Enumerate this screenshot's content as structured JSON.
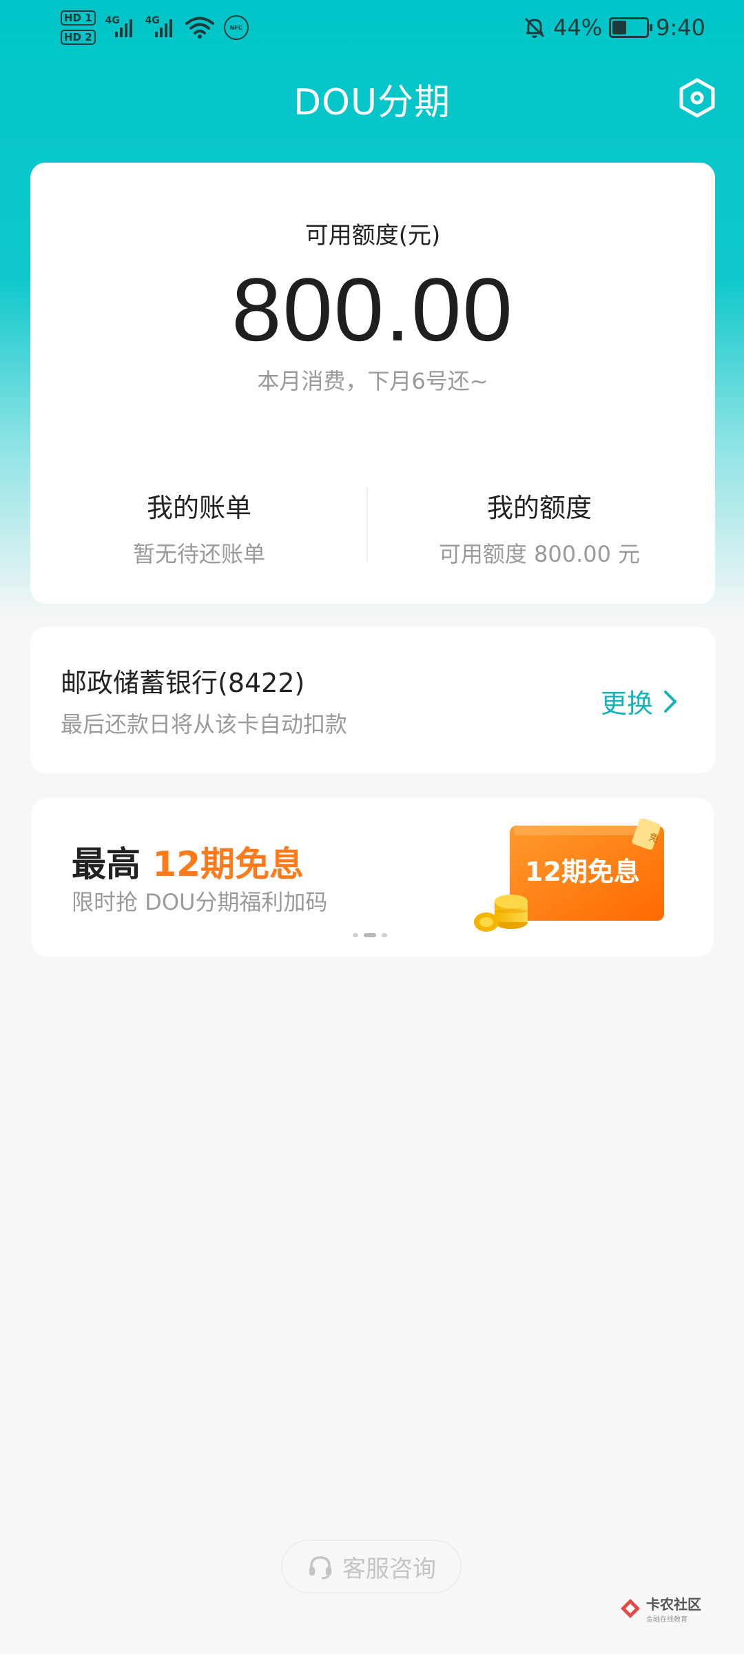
{
  "status_bar": {
    "hd1": "HD 1",
    "hd2": "HD 2",
    "net1": "4G",
    "net2": "4G",
    "nfc": "NFC",
    "battery_pct": "44%",
    "battery_level": 0.44,
    "time": "9:40"
  },
  "header": {
    "title": "DOU分期",
    "settings_icon": "settings-hexagon-icon"
  },
  "credit": {
    "label": "可用额度(元)",
    "amount": "800.00",
    "note": "本月消费，下月6号还~",
    "bill_title": "我的账单",
    "bill_sub": "暂无待还账单",
    "limit_title": "我的额度",
    "limit_sub": "可用额度 800.00 元"
  },
  "bank": {
    "name": "邮政储蓄银行(8422)",
    "note": "最后还款日将从该卡自动扣款",
    "change_label": "更换"
  },
  "promo": {
    "title_prefix": "最高 ",
    "title_highlight": "12期免息",
    "subtitle": "限时抢 DOU分期福利加码",
    "art_text": "12期免息",
    "art_tag": "免",
    "carousel_total": 3,
    "carousel_active": 2
  },
  "footer": {
    "service_label": "客服咨询",
    "watermark_main": "卡农社区",
    "watermark_sub": "金融在线教育"
  },
  "colors": {
    "accent": "#00c5c8",
    "link": "#14b3b7",
    "promo_orange": "#ff7a1a"
  }
}
